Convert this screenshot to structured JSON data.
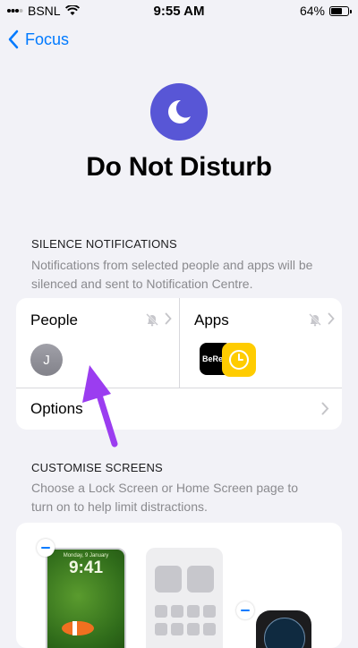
{
  "status_bar": {
    "carrier": "BSNL",
    "time": "9:55 AM",
    "battery": "64%",
    "battery_level": 0.64
  },
  "nav": {
    "back_label": "Focus"
  },
  "header": {
    "title": "Do Not Disturb",
    "icon": "moon-icon",
    "icon_color": "#5856d6"
  },
  "silence_notifications": {
    "header": "SILENCE NOTIFICATIONS",
    "description": "Notifications from selected people and apps will be silenced and sent to Notification Centre.",
    "people": {
      "label": "People",
      "avatar_initial": "J"
    },
    "apps": {
      "label": "Apps",
      "app_icons": [
        "BeReal",
        "clock-icon"
      ],
      "app_text": "BeRe"
    },
    "options_label": "Options"
  },
  "customise_screens": {
    "header": "CUSTOMISE SCREENS",
    "description": "Choose a Lock Screen or Home Screen page to turn on to help limit distractions.",
    "lock_screen": {
      "date": "Monday, 9 January",
      "time": "9:41"
    }
  },
  "colors": {
    "accent": "#007aff",
    "background": "#f2f2f7",
    "annotation_arrow": "#9b3df0"
  }
}
